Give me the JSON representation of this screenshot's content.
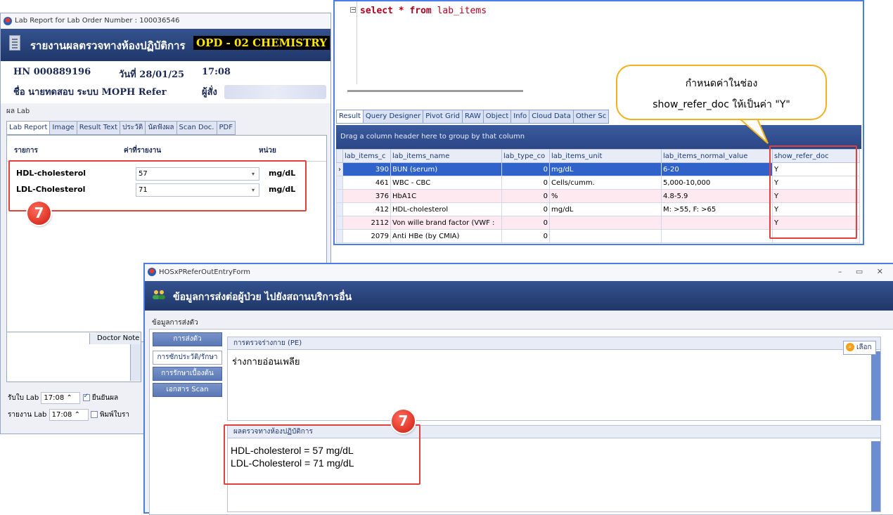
{
  "lab_window": {
    "title": "Lab Report for Lab Order Number : 100036546",
    "header_title": "รายงานผลตรวจทางห้องปฏิบัติการ",
    "header_badge": "OPD - 02 CHEMISTRY",
    "hn_label": "HN",
    "hn_value": "000889196",
    "date_label": "วันที่",
    "date_value": "28/01/25",
    "time_value": "17:08",
    "name_label": "ชื่อ",
    "name_value": "นายทดสอบ ระบบ MOPH Refer",
    "orderer_label": "ผู้สั่ง",
    "section_label": "ผล Lab",
    "tabs": [
      "Lab Report",
      "Image",
      "Result Text",
      "ประวัติ",
      "นัดฟังผล",
      "Scan Doc.",
      "PDF"
    ],
    "columns": {
      "item": "รายการ",
      "value": "ค่าที่รายงาน",
      "unit": "หน่วย"
    },
    "lab_rows": [
      {
        "name": "HDL-cholesterol",
        "value": "57",
        "unit": "mg/dL"
      },
      {
        "name": "LDL-Cholesterol",
        "value": "71",
        "unit": "mg/dL"
      }
    ],
    "marker": "7",
    "doctor_note_label": "Doctor Note",
    "receive_label": "รับใบ Lab",
    "receive_time": "17:08",
    "confirm_label": "ยืนยันผล",
    "report_label": "รายงาน Lab",
    "report_time": "17:08",
    "print_label": "พิมพ์ใบรา"
  },
  "sql_window": {
    "query_keyword1": "select",
    "query_star": "*",
    "query_keyword2": "from",
    "query_table": "lab_items",
    "result_tabs": [
      "Result",
      "Query Designer",
      "Pivot Grid",
      "RAW",
      "Object",
      "Info",
      "Cloud Data",
      "Other Sc"
    ],
    "group_hint": "Drag a column header here to group by that column",
    "columns": [
      "lab_items_c",
      "lab_items_name",
      "lab_type_co",
      "lab_items_unit",
      "lab_items_normal_value",
      "show_refer_doc"
    ],
    "rows": [
      {
        "code": "390",
        "name": "BUN (serum)",
        "type": "0",
        "unit": "mg/dL",
        "normal": "6-20",
        "show": "Y"
      },
      {
        "code": "461",
        "name": "WBC - CBC",
        "type": "0",
        "unit": "Cells/cumm.",
        "normal": "5,000-10,000",
        "show": "Y"
      },
      {
        "code": "376",
        "name": "HbA1C",
        "type": "0",
        "unit": "%",
        "normal": "4.8-5.9",
        "show": "Y"
      },
      {
        "code": "412",
        "name": "HDL-cholesterol",
        "type": "0",
        "unit": "mg/dL",
        "normal": "M: >55, F: >65",
        "show": "Y"
      },
      {
        "code": "2112",
        "name": "Von wille brand factor (VWF :",
        "type": "0",
        "unit": "",
        "normal": "",
        "show": "Y"
      },
      {
        "code": "2079",
        "name": "Anti HBe (by CMIA)",
        "type": "0",
        "unit": "",
        "normal": "",
        "show": ""
      }
    ]
  },
  "callout": {
    "line1": "กำหนดค่าในช่อง",
    "line2": "show_refer_doc ให้เป็นค่า \"Y\""
  },
  "refer_window": {
    "title": "HOSxPReferOutEntryForm",
    "header_title": "ข้อมูลการส่งต่อผู้ป่วย ไปยังสถานบริการอื่น",
    "section_tab": "ข้อมูลการส่งตัว",
    "side_buttons": [
      "การส่งตัว",
      "การซักประวัติ/รักษา",
      "การรักษาเบื้องต้น",
      "เอกสาร Scan"
    ],
    "pe_label": "การตรวจร่างกาย (PE)",
    "pe_text": "ร่างกายอ่อนเพลีย",
    "select_button": "เลือก",
    "lab_label": "ผลตรวจทางห้องปฏิบัติการ",
    "lab_lines": [
      "HDL-cholesterol = 57 mg/dL",
      "LDL-Cholesterol = 71 mg/dL"
    ],
    "marker": "7",
    "win_controls": "– ▭ ✕"
  },
  "colors": {
    "accent": "#e2413b",
    "header": "#1f3769",
    "callout_border": "#f2b21d",
    "selected_row": "#2f63c9"
  }
}
